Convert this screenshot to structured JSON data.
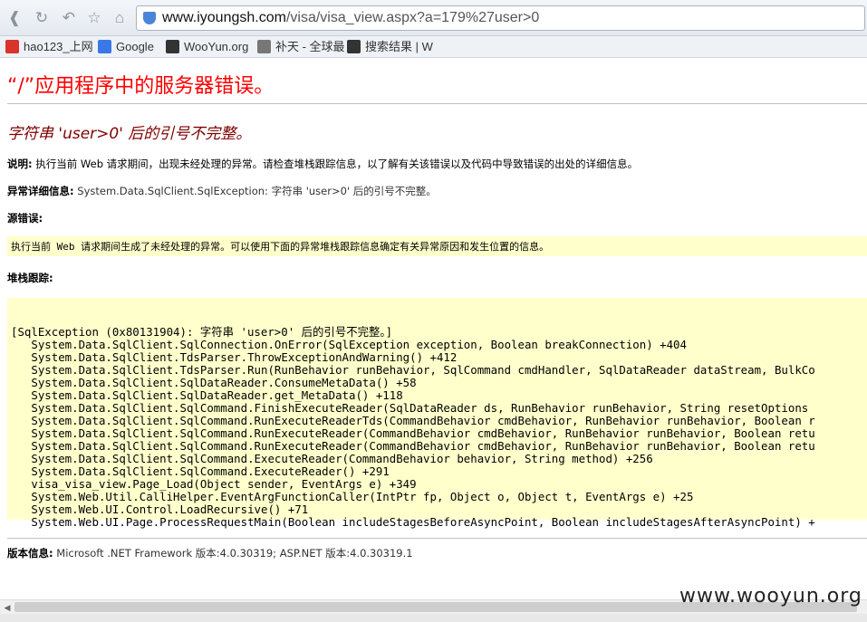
{
  "browser": {
    "url_host": "www.iyoungsh.com",
    "url_rest": "/visa/visa_view.aspx?a=179%27user>0",
    "bookmarks": [
      {
        "label": "hao123_上网",
        "color": "#d9332b"
      },
      {
        "label": "Google",
        "color": "#3b78e7"
      },
      {
        "label": "WooYun.org",
        "color": "#333333"
      },
      {
        "label": "补天 - 全球最",
        "color": "#777777"
      },
      {
        "label": "搜索结果 | W",
        "color": "#333333"
      }
    ]
  },
  "page": {
    "error_title": "“/”应用程序中的服务器错误。",
    "error_subtitle": "字符串 'user>0' 后的引号不完整。",
    "description_label": "说明:",
    "description_text": "执行当前 Web 请求期间，出现未经处理的异常。请检查堆栈跟踪信息，以了解有关该错误以及代码中导致错误的出处的详细信息。",
    "exception_label": "异常详细信息:",
    "exception_text": "System.Data.SqlClient.SqlException: 字符串 'user>0' 后的引号不完整。",
    "source_label": "源错误:",
    "source_text": "执行当前 Web 请求期间生成了未经处理的异常。可以使用下面的异常堆栈跟踪信息确定有关异常原因和发生位置的信息。",
    "stack_label": "堆栈跟踪:",
    "stack_trace": "\n[SqlException (0x80131904): 字符串 'user>0' 后的引号不完整。]\n   System.Data.SqlClient.SqlConnection.OnError(SqlException exception, Boolean breakConnection) +404\n   System.Data.SqlClient.TdsParser.ThrowExceptionAndWarning() +412\n   System.Data.SqlClient.TdsParser.Run(RunBehavior runBehavior, SqlCommand cmdHandler, SqlDataReader dataStream, BulkCo\n   System.Data.SqlClient.SqlDataReader.ConsumeMetaData() +58\n   System.Data.SqlClient.SqlDataReader.get_MetaData() +118\n   System.Data.SqlClient.SqlCommand.FinishExecuteReader(SqlDataReader ds, RunBehavior runBehavior, String resetOptions\n   System.Data.SqlClient.SqlCommand.RunExecuteReaderTds(CommandBehavior cmdBehavior, RunBehavior runBehavior, Boolean r\n   System.Data.SqlClient.SqlCommand.RunExecuteReader(CommandBehavior cmdBehavior, RunBehavior runBehavior, Boolean retu\n   System.Data.SqlClient.SqlCommand.RunExecuteReader(CommandBehavior cmdBehavior, RunBehavior runBehavior, Boolean retu\n   System.Data.SqlClient.SqlCommand.ExecuteReader(CommandBehavior behavior, String method) +256\n   System.Data.SqlClient.SqlCommand.ExecuteReader() +291\n   visa_visa_view.Page_Load(Object sender, EventArgs e) +349\n   System.Web.Util.CalliHelper.EventArgFunctionCaller(IntPtr fp, Object o, Object t, EventArgs e) +25\n   System.Web.UI.Control.LoadRecursive() +71\n   System.Web.UI.Page.ProcessRequestMain(Boolean includeStagesBeforeAsyncPoint, Boolean includeStagesAfterAsyncPoint) +",
    "version_label": "版本信息:",
    "version_text": "Microsoft .NET Framework 版本:4.0.30319; ASP.NET 版本:4.0.30319.1"
  },
  "watermark": "www.wooyun.org"
}
